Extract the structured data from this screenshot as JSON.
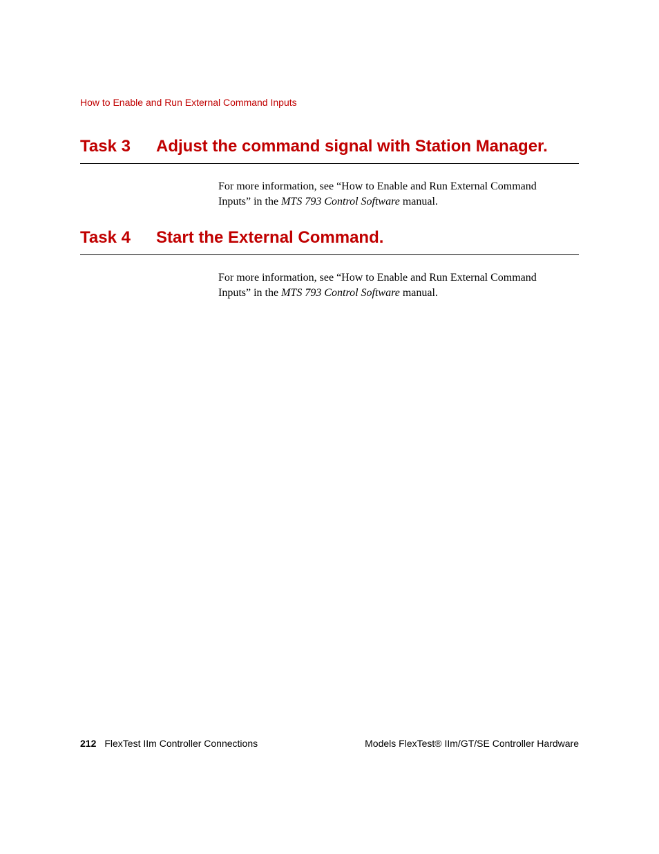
{
  "running_header": "How to Enable and Run External Command Inputs",
  "tasks": [
    {
      "label": "Task 3",
      "title": "Adjust the command signal with Station Manager.",
      "para_prefix": "For more information, see “How to Enable and Run External Command Inputs” in the ",
      "para_italic": "MTS 793 Control Software",
      "para_suffix": " manual."
    },
    {
      "label": "Task 4",
      "title": "Start the External Command.",
      "para_prefix": "For more information, see “How to Enable and Run External Command Inputs” in the ",
      "para_italic": "MTS 793 Control Software",
      "para_suffix": " manual."
    }
  ],
  "footer": {
    "page_number": "212",
    "section": "FlexTest IIm Controller Connections",
    "doc_title": "Models FlexTest® IIm/GT/SE Controller Hardware"
  }
}
